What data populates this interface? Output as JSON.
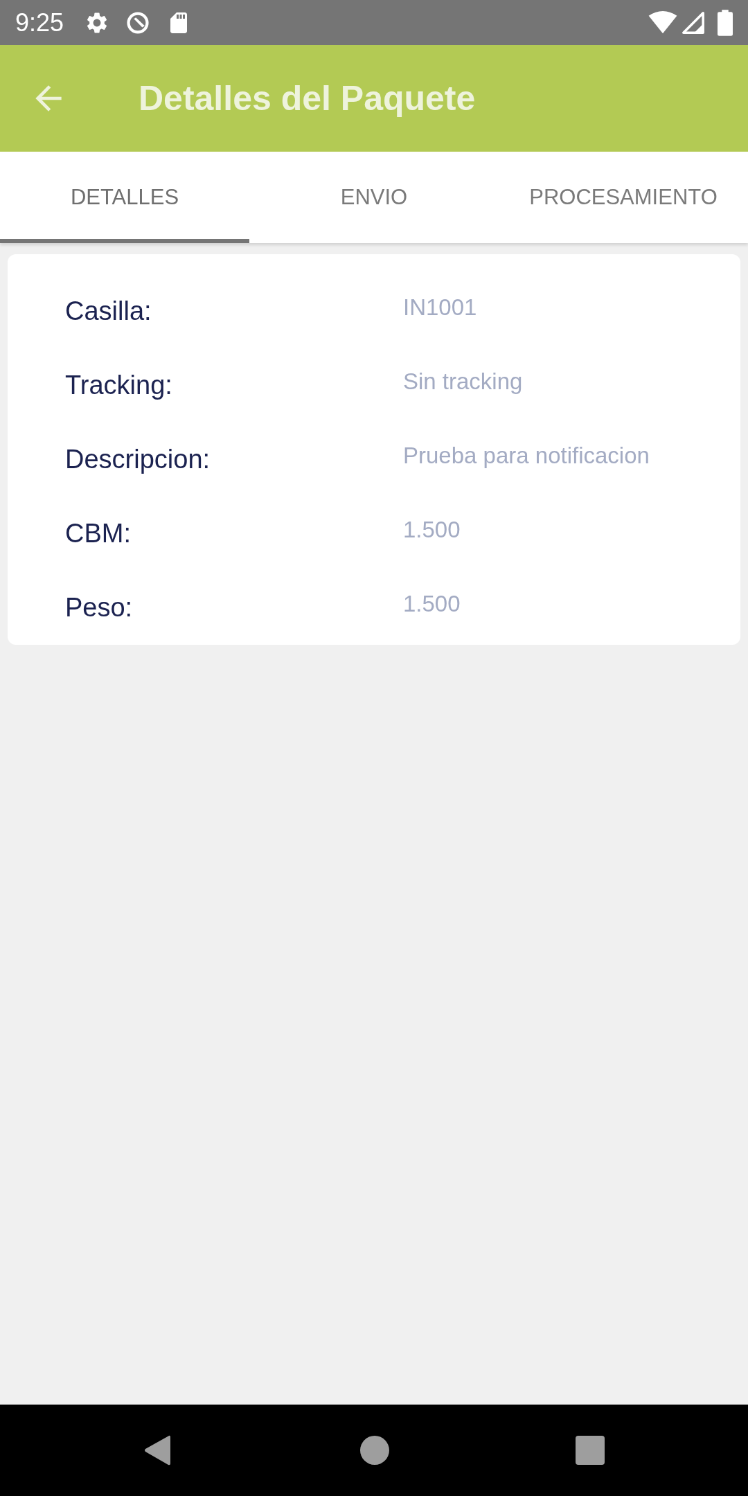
{
  "status_bar": {
    "time": "9:25"
  },
  "app_bar": {
    "title": "Detalles del Paquete"
  },
  "tabs": [
    {
      "label": "DETALLES",
      "selected": true
    },
    {
      "label": "ENVIO",
      "selected": false
    },
    {
      "label": "PROCESAMIENTO",
      "selected": false
    }
  ],
  "details": [
    {
      "label": "Casilla:",
      "value": "IN1001"
    },
    {
      "label": "Tracking:",
      "value": "Sin tracking"
    },
    {
      "label": "Descripcion:",
      "value": "Prueba para notificacion"
    },
    {
      "label": "CBM:",
      "value": "1.500"
    },
    {
      "label": "Peso:",
      "value": "1.500"
    }
  ]
}
